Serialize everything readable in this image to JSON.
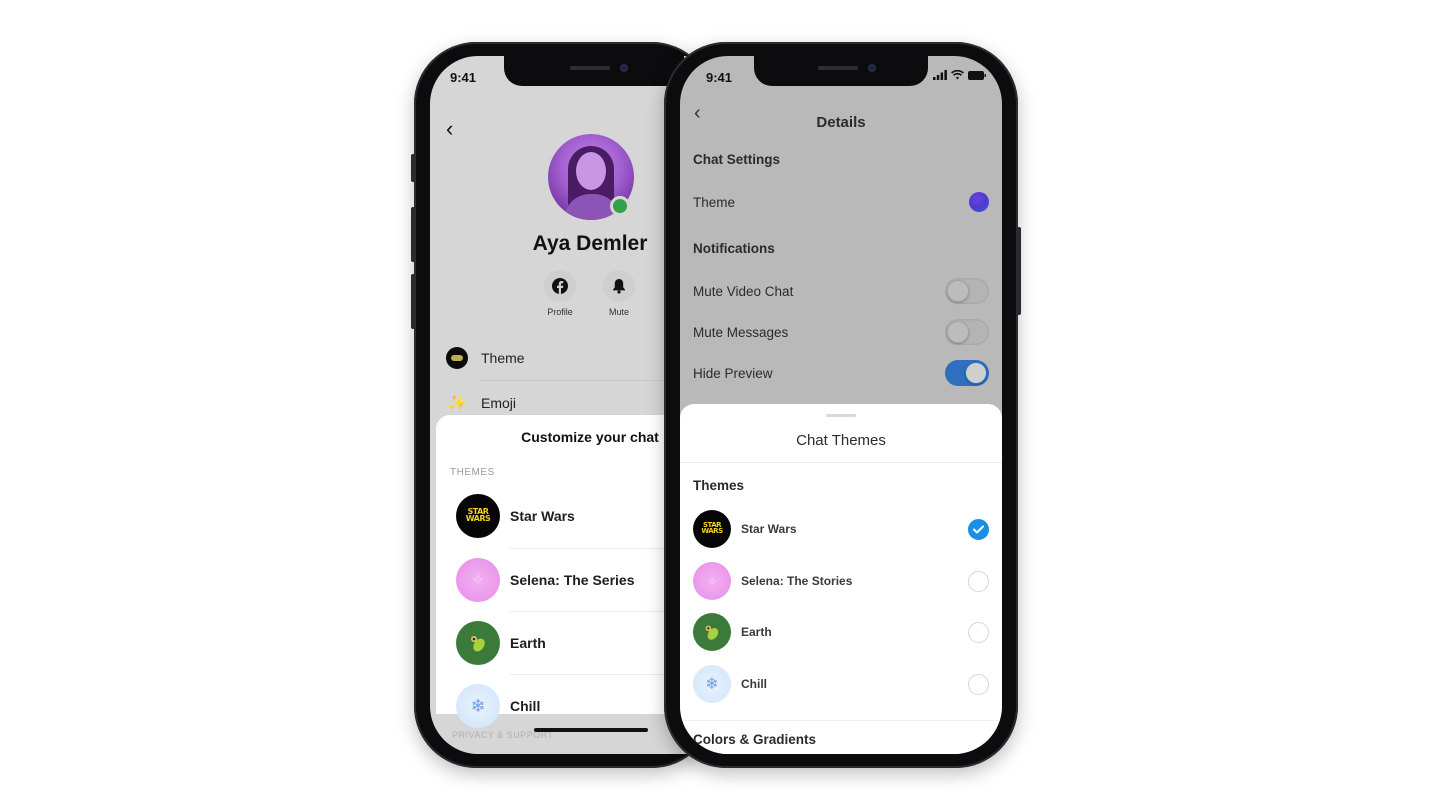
{
  "left_phone": {
    "status_time": "9:41",
    "contact": {
      "name": "Aya Demler",
      "online": true
    },
    "actions": [
      {
        "label": "Profile",
        "icon": "facebook-icon"
      },
      {
        "label": "Mute",
        "icon": "bell-icon"
      }
    ],
    "menu_items": [
      {
        "label": "Theme",
        "icon": "theme-icon"
      },
      {
        "label": "Emoji",
        "icon": "sparkle-icon"
      }
    ],
    "sheet": {
      "title": "Customize your chat",
      "section_label": "THEMES",
      "themes": [
        {
          "name": "Star Wars",
          "logo": "STAR WARS"
        },
        {
          "name": "Selena: The Series"
        },
        {
          "name": "Earth"
        },
        {
          "name": "Chill"
        }
      ],
      "footer_label": "PRIVACY & SUPPORT"
    }
  },
  "right_phone": {
    "status_time": "9:41",
    "header_title": "Details",
    "chat_settings": {
      "section": "Chat Settings",
      "theme_label": "Theme",
      "theme_color": "#4a3bd0"
    },
    "notifications": {
      "section": "Notifications",
      "toggles": [
        {
          "label": "Mute Video Chat",
          "on": false
        },
        {
          "label": "Mute Messages",
          "on": false
        },
        {
          "label": "Hide Preview",
          "on": true
        }
      ]
    },
    "sheet": {
      "title": "Chat Themes",
      "section": "Themes",
      "themes": [
        {
          "name": "Star Wars",
          "selected": true,
          "logo": "STAR WARS"
        },
        {
          "name": "Selena: The Stories",
          "selected": false
        },
        {
          "name": "Earth",
          "selected": false
        },
        {
          "name": "Chill",
          "selected": false
        }
      ],
      "next_section": "Colors & Gradients"
    }
  },
  "colors": {
    "accent_blue": "#1a8fe8",
    "toggle_on": "#2e6fc0",
    "online_green": "#31a24c"
  }
}
